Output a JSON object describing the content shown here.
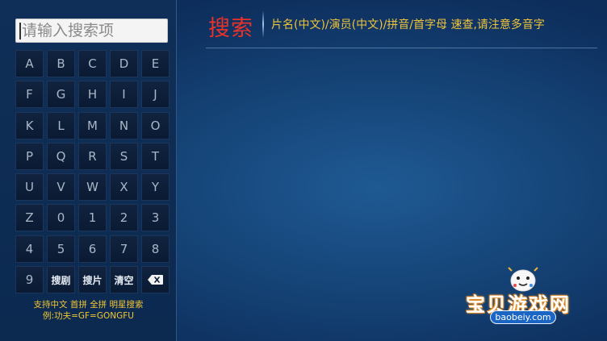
{
  "search": {
    "placeholder": "请输入搜索项"
  },
  "keyboard": {
    "keys": [
      "A",
      "B",
      "C",
      "D",
      "E",
      "F",
      "G",
      "H",
      "I",
      "J",
      "K",
      "L",
      "M",
      "N",
      "O",
      "P",
      "Q",
      "R",
      "S",
      "T",
      "U",
      "V",
      "W",
      "X",
      "Y",
      "Z",
      "0",
      "1",
      "2",
      "3",
      "4",
      "5",
      "6",
      "7",
      "8",
      "9"
    ],
    "action_keys": {
      "search_drama": "搜剧",
      "search_movie": "搜片",
      "clear": "清空"
    },
    "backspace_icon": "backspace-icon"
  },
  "hints": {
    "line1": "支持中文 首拼 全拼 明星搜索",
    "line2": "例:功夫=GF=GONGFU"
  },
  "header": {
    "title": "搜索",
    "hint": "片名(中文)/演员(中文)/拼音/首字母 速查,请注意多音字"
  },
  "watermark": {
    "brand": "宝贝游戏网",
    "domain": "baobeiy.com",
    "mascot_icon": "game-controller-mascot-icon"
  },
  "colors": {
    "title_red": "#e8332b",
    "hint_yellow": "#f0c43a",
    "background_blue": "#16467a"
  }
}
